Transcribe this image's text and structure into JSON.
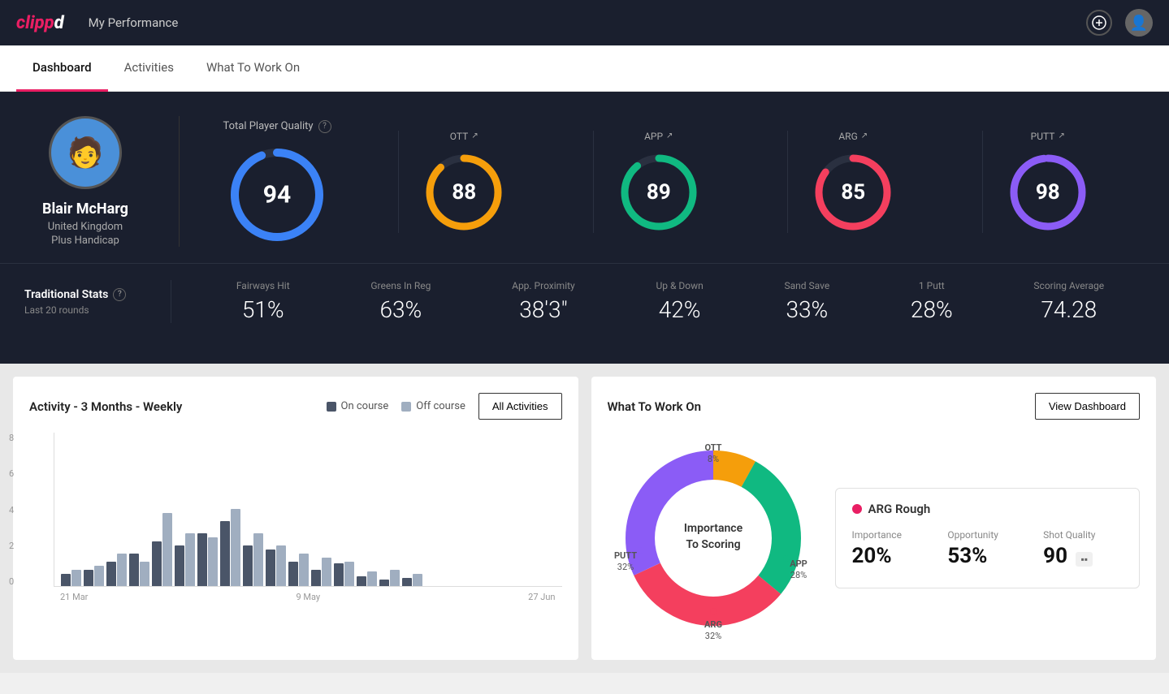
{
  "header": {
    "logo": "clippd",
    "title": "My Performance"
  },
  "tabs": [
    {
      "id": "dashboard",
      "label": "Dashboard",
      "active": true
    },
    {
      "id": "activities",
      "label": "Activities",
      "active": false
    },
    {
      "id": "what-to-work-on",
      "label": "What To Work On",
      "active": false
    }
  ],
  "player": {
    "name": "Blair McHarg",
    "country": "United Kingdom",
    "handicap": "Plus Handicap"
  },
  "total_quality": {
    "label": "Total Player Quality",
    "value": 94,
    "color": "#3b82f6",
    "percentage": 94
  },
  "scores": [
    {
      "id": "ott",
      "label": "OTT",
      "value": 88,
      "color": "#f59e0b",
      "percentage": 88
    },
    {
      "id": "app",
      "label": "APP",
      "value": 89,
      "color": "#10b981",
      "percentage": 89
    },
    {
      "id": "arg",
      "label": "ARG",
      "value": 85,
      "color": "#f43f5e",
      "percentage": 85
    },
    {
      "id": "putt",
      "label": "PUTT",
      "value": 98,
      "color": "#8b5cf6",
      "percentage": 98
    }
  ],
  "traditional_stats": {
    "title": "Traditional Stats",
    "subtitle": "Last 20 rounds",
    "stats": [
      {
        "label": "Fairways Hit",
        "value": "51%"
      },
      {
        "label": "Greens In Reg",
        "value": "63%"
      },
      {
        "label": "App. Proximity",
        "value": "38'3\""
      },
      {
        "label": "Up & Down",
        "value": "42%"
      },
      {
        "label": "Sand Save",
        "value": "33%"
      },
      {
        "label": "1 Putt",
        "value": "28%"
      },
      {
        "label": "Scoring Average",
        "value": "74.28"
      }
    ]
  },
  "activity_chart": {
    "title": "Activity - 3 Months - Weekly",
    "legend": [
      {
        "label": "On course",
        "color": "#4a5568"
      },
      {
        "label": "Off course",
        "color": "#a0aec0"
      }
    ],
    "all_activities_btn": "All Activities",
    "x_labels": [
      "21 Mar",
      "9 May",
      "27 Jun"
    ],
    "y_labels": [
      "8",
      "6",
      "4",
      "2",
      "0"
    ],
    "bars": [
      {
        "dark": 15,
        "light": 20
      },
      {
        "dark": 20,
        "light": 25
      },
      {
        "dark": 35,
        "light": 20
      },
      {
        "dark": 40,
        "light": 30
      },
      {
        "dark": 50,
        "light": 80
      },
      {
        "dark": 45,
        "light": 60
      },
      {
        "dark": 60,
        "light": 55
      },
      {
        "dark": 75,
        "light": 90
      },
      {
        "dark": 55,
        "light": 70
      },
      {
        "dark": 45,
        "light": 50
      },
      {
        "dark": 30,
        "light": 40
      },
      {
        "dark": 15,
        "light": 35
      },
      {
        "dark": 25,
        "light": 30
      },
      {
        "dark": 10,
        "light": 15
      },
      {
        "dark": 5,
        "light": 20
      },
      {
        "dark": 10,
        "light": 15
      }
    ]
  },
  "what_to_work_on": {
    "title": "What To Work On",
    "view_dashboard_btn": "View Dashboard",
    "donut_center": "Importance\nTo Scoring",
    "segments": [
      {
        "label": "OTT",
        "value": "8%",
        "color": "#f59e0b",
        "percent": 8
      },
      {
        "label": "APP",
        "value": "28%",
        "color": "#10b981",
        "percent": 28
      },
      {
        "label": "ARG",
        "value": "32%",
        "color": "#f43f5e",
        "percent": 32
      },
      {
        "label": "PUTT",
        "value": "32%",
        "color": "#8b5cf6",
        "percent": 32
      }
    ],
    "detail_card": {
      "title": "ARG Rough",
      "dot_color": "#e91e63",
      "metrics": [
        {
          "label": "Importance",
          "value": "20%"
        },
        {
          "label": "Opportunity",
          "value": "53%"
        },
        {
          "label": "Shot Quality",
          "value": "90",
          "badge": ""
        }
      ]
    }
  }
}
